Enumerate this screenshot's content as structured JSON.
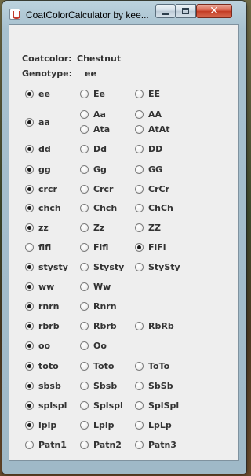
{
  "window": {
    "title": "CoatColorCalculator by kee...",
    "close_glyph": "✕"
  },
  "info": {
    "coatcolor_label": "Coatcolor:",
    "coatcolor_value": "Chestnut",
    "genotype_label": "Genotype:",
    "genotype_value": "ee"
  },
  "options": {
    "ee": "ee",
    "Ee": "Ee",
    "EE": "EE",
    "aa": "aa",
    "Aa": "Aa",
    "AA": "AA",
    "Ata": "Ata",
    "AtAt": "AtAt",
    "dd": "dd",
    "Dd": "Dd",
    "DD": "DD",
    "gg": "gg",
    "Gg": "Gg",
    "GG": "GG",
    "crcr": "crcr",
    "Crcr": "Crcr",
    "CrCr": "CrCr",
    "chch": "chch",
    "Chch": "Chch",
    "ChCh": "ChCh",
    "zz": "zz",
    "Zz": "Zz",
    "ZZ": "ZZ",
    "flfl": "flfl",
    "Flfl": "Flfl",
    "FlFl": "FlFl",
    "stysty": "stysty",
    "Stysty": "Stysty",
    "StySty": "StySty",
    "ww": "ww",
    "Ww": "Ww",
    "rnrn": "rnrn",
    "Rnrn": "Rnrn",
    "rbrb": "rbrb",
    "Rbrb": "Rbrb",
    "RbRb": "RbRb",
    "oo": "oo",
    "Oo": "Oo",
    "toto": "toto",
    "Toto": "Toto",
    "ToTo": "ToTo",
    "sbsb": "sbsb",
    "Sbsb": "Sbsb",
    "SbSb": "SbSb",
    "splspl": "splspl",
    "Splspl": "Splspl",
    "SplSpl": "SplSpl",
    "lplp": "lplp",
    "Lplp": "Lplp",
    "LpLp": "LpLp",
    "Patn1": "Patn1",
    "Patn2": "Patn2",
    "Patn3": "Patn3"
  }
}
